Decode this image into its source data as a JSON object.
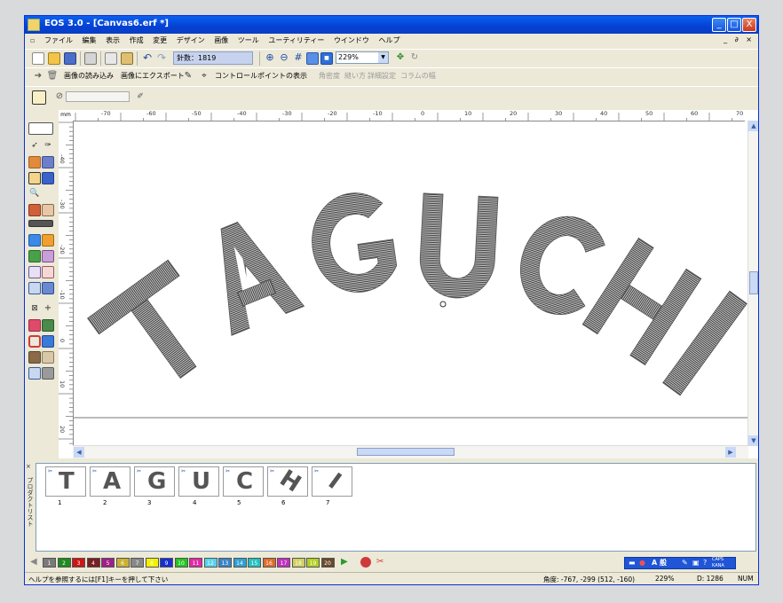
{
  "window": {
    "title": "EOS 3.0 - [Canvas6.erf *]",
    "minimize": "_",
    "maximize": "□",
    "close": "X"
  },
  "menu": {
    "items": [
      "ファイル",
      "編集",
      "表示",
      "作成",
      "変更",
      "デザイン",
      "画像",
      "ツール",
      "ユーティリティー",
      "ウインドウ",
      "ヘルプ"
    ],
    "doc_controls": "_ ∂ ×"
  },
  "toolbar1": {
    "stitch_count": "針数：1819",
    "zoom_value": "229%"
  },
  "toolbar2": {
    "load_image": "画像の読み込み",
    "export_image": "画像にエクスポート",
    "show_control_points": "コントロールポイントの表示",
    "disabled_items": [
      "角密度",
      "縫い方",
      "詳細設定",
      "コラムの幅"
    ]
  },
  "ruler": {
    "corner": "mm",
    "h_labels": [
      "-70",
      "-60",
      "-50",
      "-40",
      "-30",
      "-20",
      "-10",
      "0",
      "10",
      "20",
      "30",
      "40",
      "50",
      "60",
      "70"
    ],
    "v_labels": [
      "-40",
      "-30",
      "-20",
      "-10",
      "0",
      "10",
      "20",
      "30"
    ]
  },
  "canvas": {
    "design_text": "TAGUCHI",
    "letters": [
      "T",
      "A",
      "G",
      "U",
      "C",
      "H",
      "I"
    ]
  },
  "product_list": {
    "label": "プロダクトリスト",
    "items": [
      {
        "num": "1",
        "glyph": "T"
      },
      {
        "num": "2",
        "glyph": "A"
      },
      {
        "num": "3",
        "glyph": "G"
      },
      {
        "num": "4",
        "glyph": "U"
      },
      {
        "num": "5",
        "glyph": "C"
      },
      {
        "num": "6",
        "glyph": "H"
      },
      {
        "num": "7",
        "glyph": "I"
      }
    ]
  },
  "palette": {
    "colors": [
      {
        "n": "1",
        "c": "#7a7a7a"
      },
      {
        "n": "2",
        "c": "#1f8a1f"
      },
      {
        "n": "3",
        "c": "#d01515"
      },
      {
        "n": "4",
        "c": "#7a1f1f"
      },
      {
        "n": "5",
        "c": "#a0208a"
      },
      {
        "n": "6",
        "c": "#c8b230"
      },
      {
        "n": "7",
        "c": "#888888"
      },
      {
        "n": "8",
        "c": "#f2f200"
      },
      {
        "n": "9",
        "c": "#1830d0"
      },
      {
        "n": "10",
        "c": "#22c422"
      },
      {
        "n": "11",
        "c": "#e02aa8"
      },
      {
        "n": "12",
        "c": "#55d2f0"
      },
      {
        "n": "13",
        "c": "#3a84c8"
      },
      {
        "n": "14",
        "c": "#30a0d0"
      },
      {
        "n": "15",
        "c": "#25c0c0"
      },
      {
        "n": "16",
        "c": "#e06a2a"
      },
      {
        "n": "17",
        "c": "#c030c0"
      },
      {
        "n": "18",
        "c": "#d0d060"
      },
      {
        "n": "19",
        "c": "#b0d020"
      },
      {
        "n": "20",
        "c": "#6a4a2a"
      }
    ]
  },
  "status": {
    "help": "ヘルプを参照するには[F1]キーを押して下さい",
    "coords": "角度: -767, -299 (512, -160)",
    "zoom": "229%",
    "d_value": "D: 1286",
    "num": "NUM"
  },
  "ime": {
    "mode": "A 般",
    "caps": "CAPS",
    "kana": "KANA"
  }
}
